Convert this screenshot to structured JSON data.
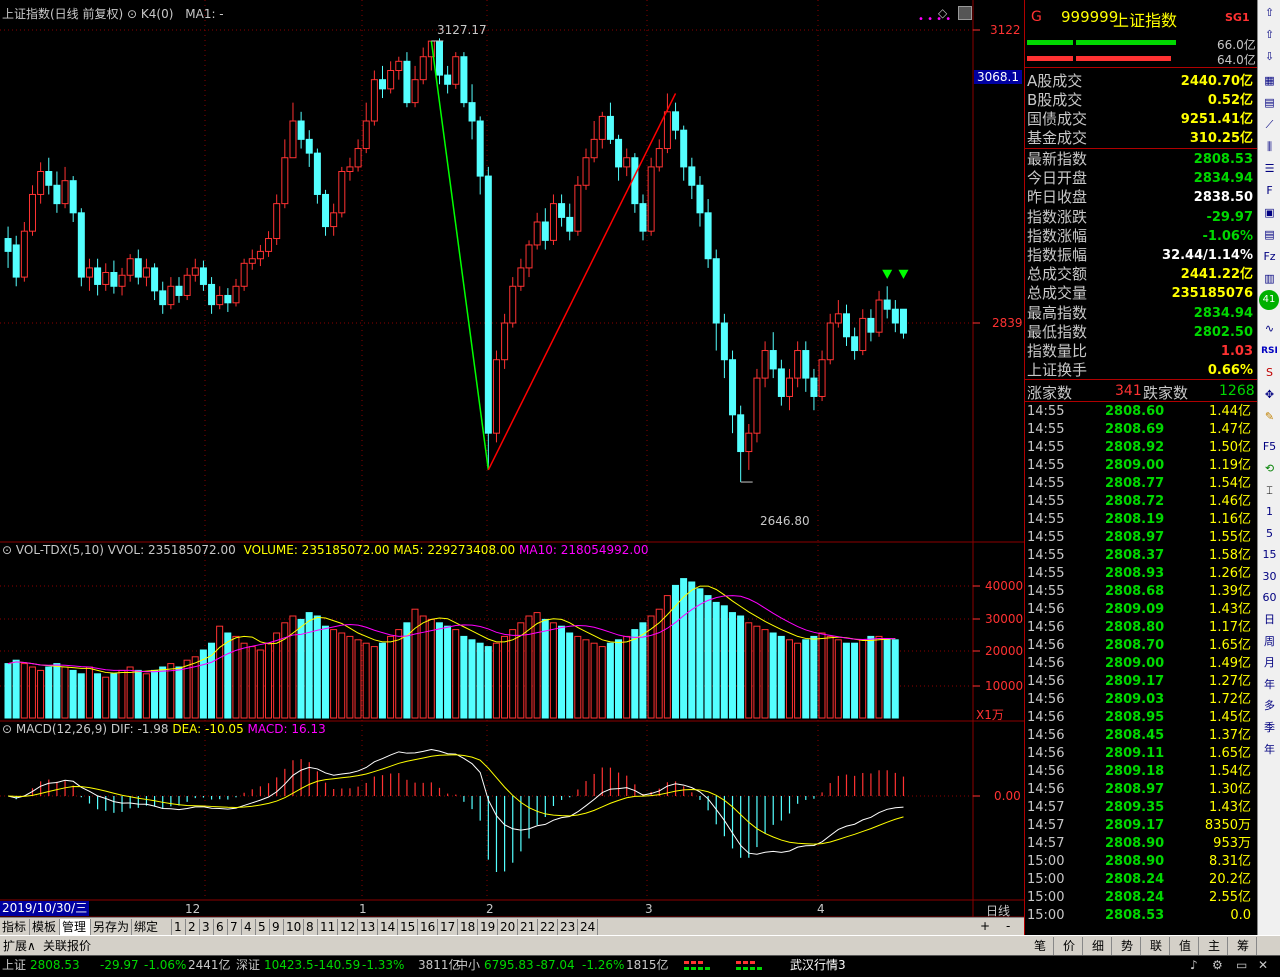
{
  "main_chart": {
    "header_title": "上证指数(日线 前复权)",
    "header_k4": "K4(0)",
    "header_ma": "MA1: -",
    "high_label": "3127.17",
    "low_label": "2646.80",
    "axis_labels": [
      "3122",
      "3068.1",
      "2839"
    ],
    "colors": {
      "up": "#ff3232",
      "down": "#54ffff",
      "bg": "#000000",
      "grid": "#8b0000"
    }
  },
  "volume_chart": {
    "header_name": "VOL-TDX(5,10)",
    "header_vvol": "VVOL: 235185072.00",
    "header_volume": "VOLUME: 235185072.00",
    "header_ma5": "MA5: 229273408.00",
    "header_ma10": "MA10: 218054992.00",
    "axis_labels": [
      "40000",
      "30000",
      "20000",
      "10000"
    ],
    "unit": "X1万"
  },
  "macd_chart": {
    "header_name": "MACD(12,26,9)",
    "header_dif": "DIF: -1.98",
    "header_dea": "DEA: -10.05",
    "header_macd": "MACD: 16.13",
    "zero_label": "0.00"
  },
  "x_axis": {
    "current_date": "2019/10/30/三",
    "month_labels": [
      "12",
      "1",
      "2",
      "3",
      "4"
    ],
    "period": "日线"
  },
  "chart_data": {
    "type": "candlestick",
    "title": "上证指数(日线 前复权)",
    "ylim": [
      2600,
      3150
    ],
    "annotations": {
      "high": 3127.17,
      "low": 2646.8
    },
    "candles": [
      [
        2912,
        2898,
        2925,
        2880
      ],
      [
        2905,
        2870,
        2915,
        2860
      ],
      [
        2870,
        2920,
        2930,
        2865
      ],
      [
        2920,
        2960,
        2970,
        2915
      ],
      [
        2960,
        2985,
        2995,
        2950
      ],
      [
        2985,
        2970,
        3000,
        2960
      ],
      [
        2970,
        2950,
        2985,
        2940
      ],
      [
        2950,
        2975,
        2990,
        2945
      ],
      [
        2975,
        2940,
        2980,
        2930
      ],
      [
        2940,
        2870,
        2945,
        2860
      ],
      [
        2870,
        2880,
        2890,
        2855
      ],
      [
        2880,
        2862,
        2890,
        2850
      ],
      [
        2862,
        2875,
        2885,
        2855
      ],
      [
        2875,
        2860,
        2888,
        2852
      ],
      [
        2860,
        2872,
        2880,
        2850
      ],
      [
        2872,
        2890,
        2895,
        2865
      ],
      [
        2890,
        2870,
        2900,
        2862
      ],
      [
        2870,
        2880,
        2890,
        2860
      ],
      [
        2880,
        2855,
        2885,
        2845
      ],
      [
        2855,
        2840,
        2865,
        2830
      ],
      [
        2840,
        2860,
        2870,
        2835
      ],
      [
        2860,
        2850,
        2870,
        2842
      ],
      [
        2850,
        2872,
        2880,
        2845
      ],
      [
        2872,
        2880,
        2890,
        2865
      ],
      [
        2880,
        2862,
        2888,
        2855
      ],
      [
        2862,
        2840,
        2870,
        2830
      ],
      [
        2840,
        2850,
        2860,
        2835
      ],
      [
        2850,
        2842,
        2858,
        2832
      ],
      [
        2842,
        2860,
        2868,
        2838
      ],
      [
        2860,
        2885,
        2890,
        2855
      ],
      [
        2885,
        2890,
        2900,
        2878
      ],
      [
        2890,
        2898,
        2905,
        2882
      ],
      [
        2898,
        2912,
        2920,
        2892
      ],
      [
        2912,
        2950,
        2960,
        2905
      ],
      [
        2950,
        3000,
        3020,
        2945
      ],
      [
        3000,
        3040,
        3060,
        3000
      ],
      [
        3040,
        3020,
        3050,
        3010
      ],
      [
        3020,
        3005,
        3030,
        2990
      ],
      [
        3005,
        2960,
        3010,
        2950
      ],
      [
        2960,
        2925,
        2965,
        2915
      ],
      [
        2925,
        2940,
        2950,
        2915
      ],
      [
        2940,
        2985,
        2990,
        2935
      ],
      [
        2985,
        2990,
        3000,
        2975
      ],
      [
        2990,
        3010,
        3020,
        2985
      ],
      [
        3010,
        3040,
        3060,
        3005
      ],
      [
        3040,
        3085,
        3095,
        3035
      ],
      [
        3085,
        3075,
        3100,
        3065
      ],
      [
        3075,
        3095,
        3105,
        3070
      ],
      [
        3095,
        3105,
        3110,
        3085
      ],
      [
        3105,
        3060,
        3115,
        3055
      ],
      [
        3060,
        3085,
        3100,
        3055
      ],
      [
        3085,
        3110,
        3120,
        3080
      ],
      [
        3110,
        3127,
        3127,
        3095
      ],
      [
        3127,
        3090,
        3130,
        3080
      ],
      [
        3090,
        3080,
        3100,
        3070
      ],
      [
        3080,
        3110,
        3115,
        3075
      ],
      [
        3110,
        3060,
        3115,
        3055
      ],
      [
        3060,
        3040,
        3080,
        3020
      ],
      [
        3040,
        2980,
        3045,
        2960
      ],
      [
        2980,
        2700,
        2990,
        2660
      ],
      [
        2700,
        2780,
        2790,
        2690
      ],
      [
        2780,
        2820,
        2830,
        2770
      ],
      [
        2820,
        2860,
        2870,
        2815
      ],
      [
        2860,
        2880,
        2890,
        2855
      ],
      [
        2880,
        2905,
        2910,
        2870
      ],
      [
        2905,
        2930,
        2940,
        2900
      ],
      [
        2930,
        2910,
        2945,
        2900
      ],
      [
        2910,
        2950,
        2960,
        2905
      ],
      [
        2950,
        2935,
        2960,
        2925
      ],
      [
        2935,
        2920,
        2950,
        2910
      ],
      [
        2920,
        2970,
        2980,
        2915
      ],
      [
        2970,
        3000,
        3010,
        2965
      ],
      [
        3000,
        3020,
        3040,
        2995
      ],
      [
        3020,
        3045,
        3050,
        3010
      ],
      [
        3045,
        3020,
        3060,
        3015
      ],
      [
        3020,
        2990,
        3025,
        2975
      ],
      [
        2990,
        3000,
        3010,
        2980
      ],
      [
        3000,
        2950,
        3005,
        2940
      ],
      [
        2950,
        2920,
        2960,
        2910
      ],
      [
        2920,
        2990,
        3000,
        2915
      ],
      [
        2990,
        3010,
        3020,
        2985
      ],
      [
        3010,
        3050,
        3070,
        3005
      ],
      [
        3050,
        3030,
        3060,
        3020
      ],
      [
        3030,
        2990,
        3035,
        2975
      ],
      [
        2990,
        2970,
        3000,
        2955
      ],
      [
        2970,
        2940,
        2980,
        2925
      ],
      [
        2940,
        2890,
        2955,
        2880
      ],
      [
        2890,
        2820,
        2900,
        2790
      ],
      [
        2820,
        2780,
        2830,
        2760
      ],
      [
        2780,
        2720,
        2790,
        2700
      ],
      [
        2720,
        2680,
        2730,
        2646.8
      ],
      [
        2680,
        2700,
        2710,
        2660
      ],
      [
        2700,
        2760,
        2770,
        2690
      ],
      [
        2760,
        2790,
        2800,
        2750
      ],
      [
        2790,
        2770,
        2810,
        2760
      ],
      [
        2770,
        2740,
        2780,
        2730
      ],
      [
        2740,
        2760,
        2770,
        2725
      ],
      [
        2760,
        2790,
        2800,
        2750
      ],
      [
        2790,
        2760,
        2800,
        2745
      ],
      [
        2760,
        2740,
        2770,
        2725
      ],
      [
        2740,
        2780,
        2790,
        2735
      ],
      [
        2780,
        2820,
        2830,
        2775
      ],
      [
        2820,
        2830,
        2845,
        2815
      ],
      [
        2830,
        2805,
        2840,
        2795
      ],
      [
        2805,
        2790,
        2815,
        2780
      ],
      [
        2790,
        2825,
        2835,
        2785
      ],
      [
        2825,
        2810,
        2835,
        2800
      ],
      [
        2810,
        2845,
        2855,
        2805
      ],
      [
        2845,
        2835,
        2860,
        2825
      ],
      [
        2835,
        2820,
        2845,
        2810
      ],
      [
        2835,
        2809,
        2835,
        2803
      ]
    ],
    "volume": [
      16,
      17,
      16,
      15,
      14,
      15,
      16,
      15,
      14,
      13,
      15,
      13,
      12,
      13,
      14,
      15,
      14,
      13,
      14,
      15,
      16,
      15,
      17,
      18,
      20,
      22,
      27,
      25,
      24,
      22,
      21,
      20,
      22,
      25,
      28,
      30,
      29,
      31,
      30,
      27,
      26,
      25,
      24,
      23,
      22,
      21,
      22,
      24,
      26,
      28,
      32,
      30,
      29,
      28,
      27,
      26,
      24,
      23,
      22,
      21,
      22,
      24,
      26,
      28,
      30,
      31,
      29,
      28,
      27,
      25,
      24,
      23,
      22,
      21,
      22,
      23,
      24,
      26,
      28,
      30,
      32,
      36,
      39,
      41,
      40,
      38,
      36,
      34,
      33,
      31,
      30,
      28,
      27,
      26,
      25,
      24,
      23,
      22,
      23,
      24,
      25,
      24,
      23,
      22,
      22,
      23,
      24,
      24,
      23,
      23
    ]
  },
  "info_panel": {
    "code_prefix": "G",
    "code": "999999",
    "name": "上证指数",
    "sg": "SG1",
    "bar_top_value": "66.0亿",
    "bar_bottom_value": "64.0亿",
    "rows": [
      {
        "label": "A股成交",
        "value": "2440.70亿",
        "color": "#ffff00"
      },
      {
        "label": "B股成交",
        "value": "0.52亿",
        "color": "#ffff00"
      },
      {
        "label": "国债成交",
        "value": "9251.41亿",
        "color": "#ffff00"
      },
      {
        "label": "基金成交",
        "value": "310.25亿",
        "color": "#ffff00"
      },
      {
        "label": "最新指数",
        "value": "2808.53",
        "color": "#00d800"
      },
      {
        "label": "今日开盘",
        "value": "2834.94",
        "color": "#00d800"
      },
      {
        "label": "昨日收盘",
        "value": "2838.50",
        "color": "#ffffff"
      },
      {
        "label": "指数涨跌",
        "value": "-29.97",
        "color": "#00d800"
      },
      {
        "label": "指数涨幅",
        "value": "-1.06%",
        "color": "#00d800"
      },
      {
        "label": "指数振幅",
        "value": "32.44/1.14%",
        "color": "#ffffff"
      },
      {
        "label": "总成交额",
        "value": "2441.22亿",
        "color": "#ffff00"
      },
      {
        "label": "总成交量",
        "value": "235185076",
        "color": "#ffff00"
      },
      {
        "label": "最高指数",
        "value": "2834.94",
        "color": "#00d800"
      },
      {
        "label": "最低指数",
        "value": "2802.50",
        "color": "#00d800"
      },
      {
        "label": "指数量比",
        "value": "1.03",
        "color": "#ff3232"
      },
      {
        "label": "上证换手",
        "value": "0.66%",
        "color": "#ffff00"
      }
    ],
    "advance_label": "涨家数",
    "advance_count": "341",
    "decline_label": "跌家数",
    "decline_count": "1268",
    "ticks": [
      {
        "time": "14:55",
        "price": "2808.60",
        "amount": "1.44亿"
      },
      {
        "time": "14:55",
        "price": "2808.69",
        "amount": "1.47亿"
      },
      {
        "time": "14:55",
        "price": "2808.92",
        "amount": "1.50亿"
      },
      {
        "time": "14:55",
        "price": "2809.00",
        "amount": "1.19亿"
      },
      {
        "time": "14:55",
        "price": "2808.77",
        "amount": "1.54亿"
      },
      {
        "time": "14:55",
        "price": "2808.72",
        "amount": "1.46亿"
      },
      {
        "time": "14:55",
        "price": "2808.19",
        "amount": "1.16亿"
      },
      {
        "time": "14:55",
        "price": "2808.97",
        "amount": "1.55亿"
      },
      {
        "time": "14:55",
        "price": "2808.37",
        "amount": "1.58亿"
      },
      {
        "time": "14:55",
        "price": "2808.93",
        "amount": "1.26亿"
      },
      {
        "time": "14:55",
        "price": "2808.68",
        "amount": "1.39亿"
      },
      {
        "time": "14:56",
        "price": "2809.09",
        "amount": "1.43亿"
      },
      {
        "time": "14:56",
        "price": "2808.80",
        "amount": "1.17亿"
      },
      {
        "time": "14:56",
        "price": "2808.70",
        "amount": "1.65亿"
      },
      {
        "time": "14:56",
        "price": "2809.00",
        "amount": "1.49亿"
      },
      {
        "time": "14:56",
        "price": "2809.17",
        "amount": "1.27亿"
      },
      {
        "time": "14:56",
        "price": "2809.03",
        "amount": "1.72亿"
      },
      {
        "time": "14:56",
        "price": "2808.95",
        "amount": "1.45亿"
      },
      {
        "time": "14:56",
        "price": "2808.45",
        "amount": "1.37亿"
      },
      {
        "time": "14:56",
        "price": "2809.11",
        "amount": "1.65亿"
      },
      {
        "time": "14:56",
        "price": "2809.18",
        "amount": "1.54亿"
      },
      {
        "time": "14:56",
        "price": "2808.97",
        "amount": "1.30亿"
      },
      {
        "time": "14:57",
        "price": "2809.35",
        "amount": "1.43亿"
      },
      {
        "time": "14:57",
        "price": "2809.17",
        "amount": "8350万"
      },
      {
        "time": "14:57",
        "price": "2808.90",
        "amount": "953万"
      },
      {
        "time": "15:00",
        "price": "2808.90",
        "amount": "8.31亿"
      },
      {
        "time": "15:00",
        "price": "2808.24",
        "amount": "20.2亿"
      },
      {
        "time": "15:00",
        "price": "2808.24",
        "amount": "2.55亿"
      },
      {
        "time": "15:00",
        "price": "2808.53",
        "amount": "0.0"
      }
    ]
  },
  "toolbar": {
    "period_buttons": [
      "1",
      "5",
      "15",
      "30",
      "60",
      "日",
      "周",
      "月",
      "年",
      "多",
      "季",
      "年"
    ],
    "rsi": "RSI",
    "badge": "41"
  },
  "tabs": {
    "items": [
      "指标",
      "模板",
      "管理",
      "另存为",
      "绑定到",
      "1",
      "2",
      "3",
      "6",
      "7",
      "4",
      "5",
      "9",
      "10",
      "8",
      "11",
      "12",
      "13",
      "14",
      "15",
      "16",
      "17",
      "18",
      "19",
      "20",
      "21",
      "22",
      "23",
      "24"
    ],
    "scroll_plus": "+",
    "scroll_minus": "-"
  },
  "nav": {
    "expand": "扩展∧",
    "quote": "关联报价",
    "panel_tabs": [
      "笔",
      "价",
      "细",
      "势",
      "联",
      "值",
      "主",
      "筹"
    ]
  },
  "status": {
    "sh_name": "上证",
    "sh_price": "2808.53",
    "sh_change": "-29.97",
    "sh_pct": "-1.06%",
    "sh_amount": "2441亿",
    "sz_name": "深证",
    "sz_price": "10423.5",
    "sz_change": "-140.59",
    "sz_pct": "-1.33%",
    "sz_amount": "3811亿",
    "zx_name": "中小",
    "zx_price": "6795.83",
    "zx_change": "-87.04",
    "zx_pct": "-1.26%",
    "zx_amount": "1815亿",
    "ticker": "武汉行情3"
  }
}
